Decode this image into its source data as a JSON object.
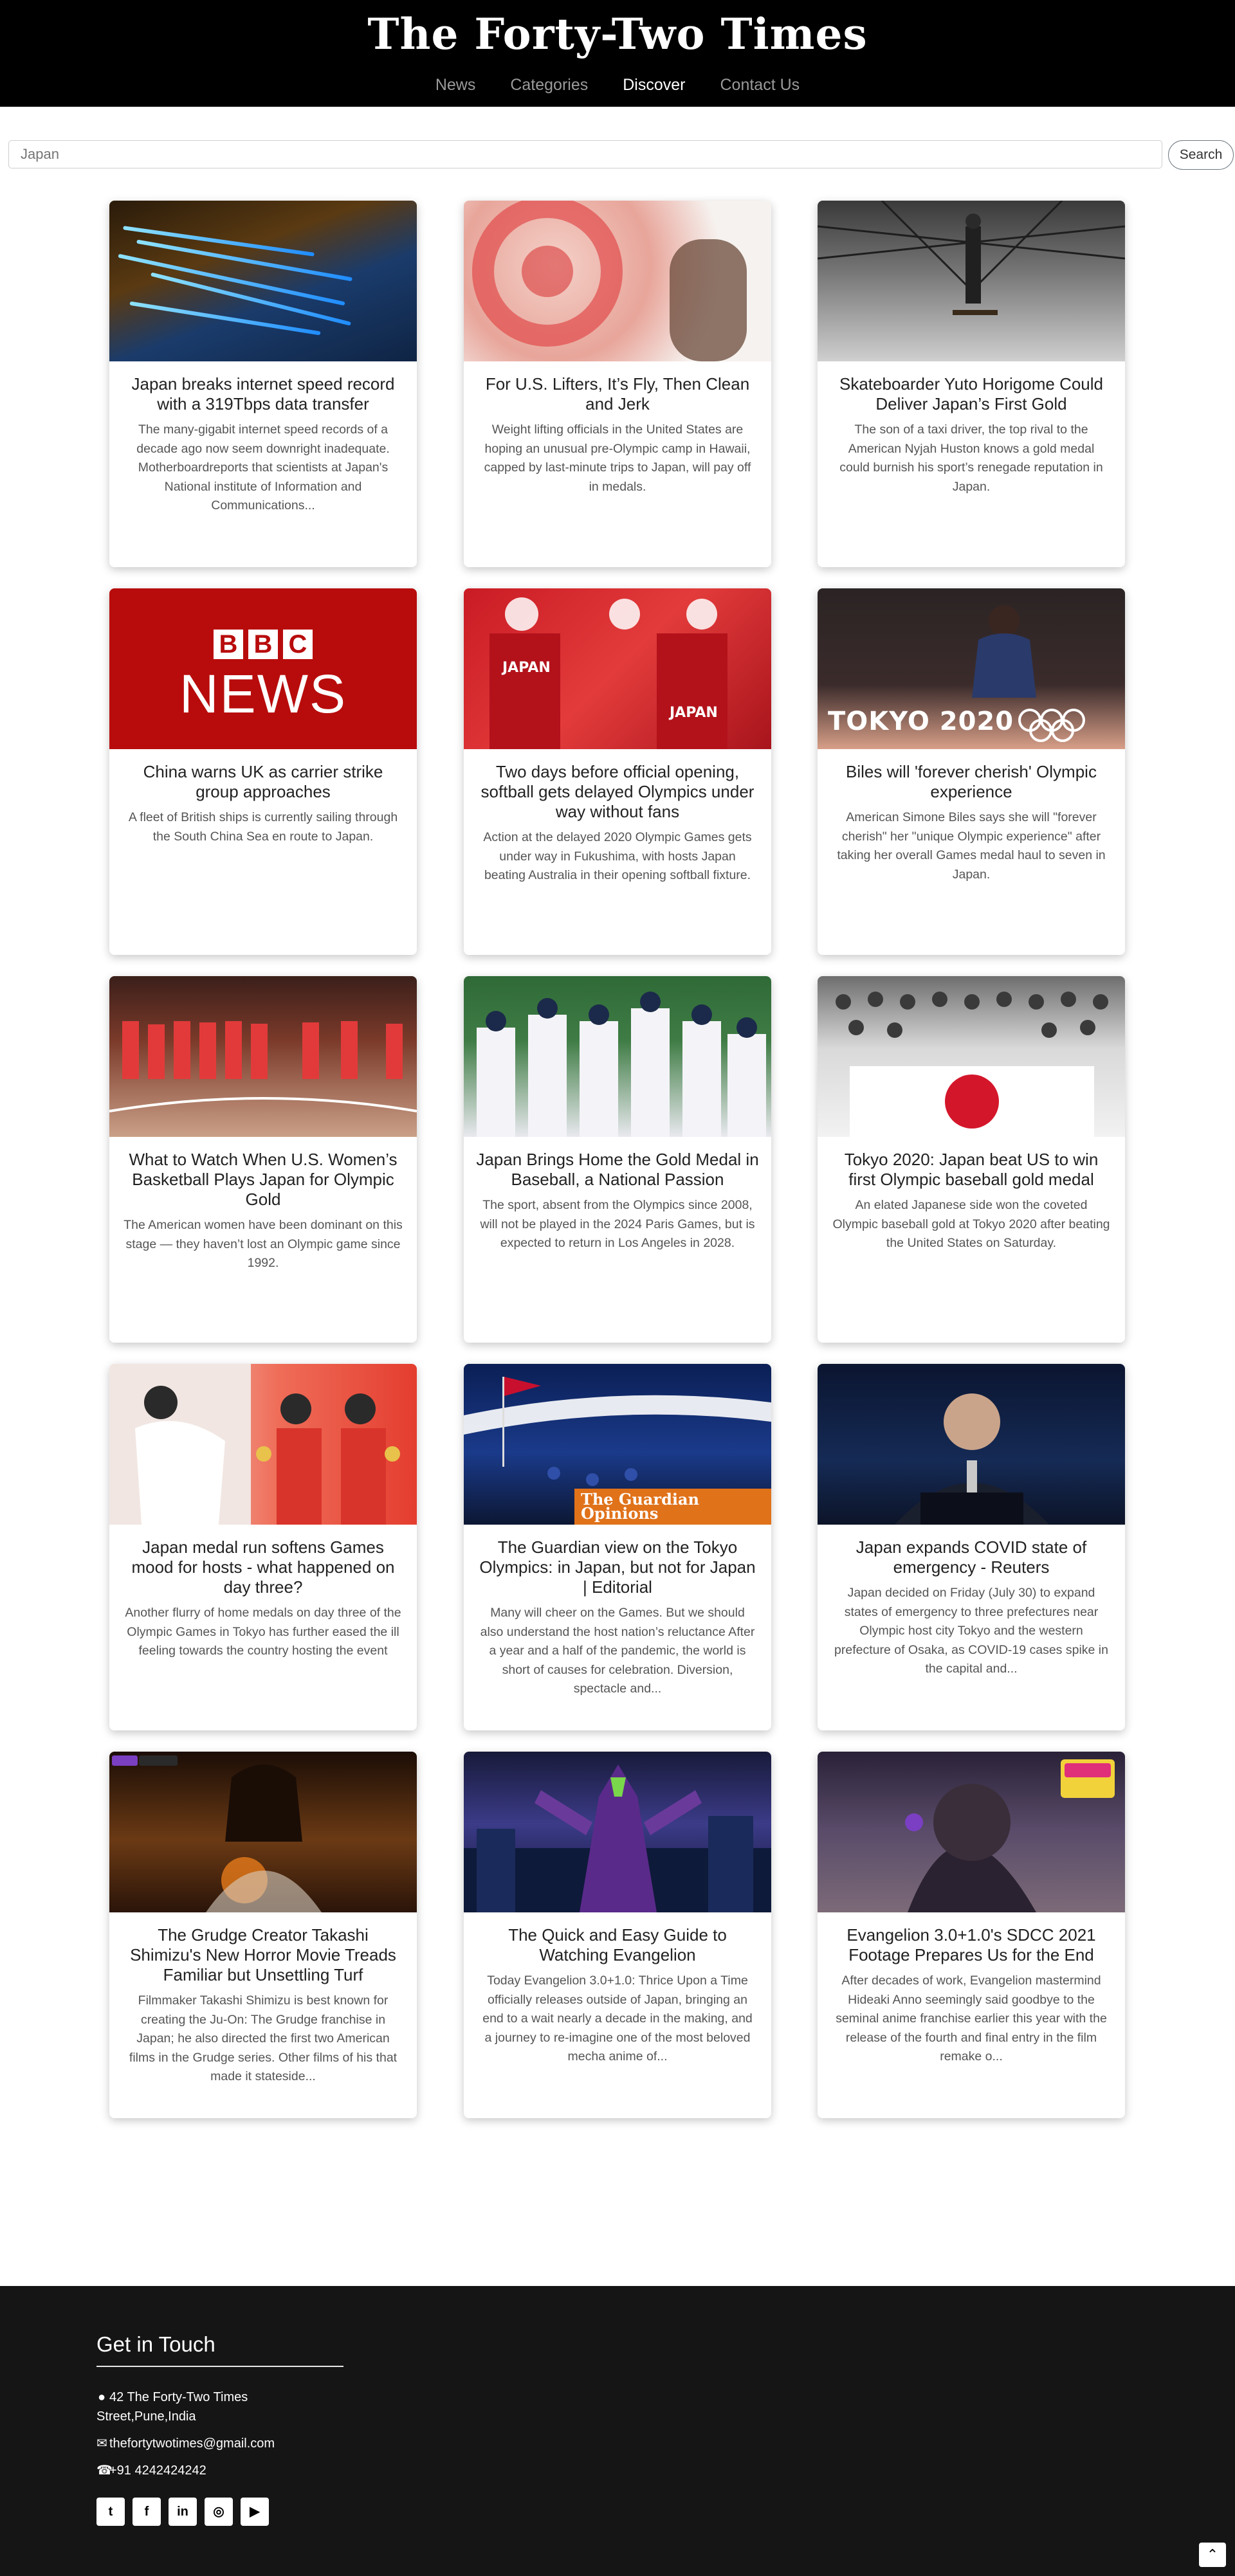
{
  "header": {
    "brand": "The Forty-Two Times",
    "nav": [
      {
        "label": "News",
        "active": false
      },
      {
        "label": "Categories",
        "active": false
      },
      {
        "label": "Discover",
        "active": true
      },
      {
        "label": "Contact Us",
        "active": false
      }
    ]
  },
  "search": {
    "placeholder": "Japan",
    "button_label": "Search"
  },
  "articles": [
    {
      "title": "Japan breaks internet speed record with a 319Tbps data transfer",
      "description": "The many-gigabit internet speed records of a decade ago now seem downright inadequate. Motherboardreports that scientists at Japan's National institute of Information and Communications..."
    },
    {
      "title": "For U.S. Lifters, It’s Fly, Then Clean and Jerk",
      "description": "Weight lifting officials in the United States are hoping an unusual pre-Olympic camp in Hawaii, capped by last-minute trips to Japan, will pay off in medals."
    },
    {
      "title": "Skateboarder Yuto Horigome Could Deliver Japan’s First Gold",
      "description": "The son of a taxi driver, the top rival to the American Nyjah Huston knows a gold medal could burnish his sport’s renegade reputation in Japan."
    },
    {
      "title": "China warns UK as carrier strike group approaches",
      "description": "A fleet of British ships is currently sailing through the South China Sea en route to Japan.",
      "thumb_logo": "BBC",
      "thumb_word": "NEWS"
    },
    {
      "title": "Two days before official opening, softball gets delayed Olympics under way without fans",
      "description": "Action at the delayed 2020 Olympic Games gets under way in Fukushima, with hosts Japan beating Australia in their opening softball fixture."
    },
    {
      "title": "Biles will 'forever cherish' Olympic experience",
      "description": "American Simone Biles says she will \"forever cherish\" her \"unique Olympic experience\" after taking her overall Games medal haul to seven in Japan.",
      "thumb_text": "TOKYO 2020"
    },
    {
      "title": "What to Watch When U.S. Women’s Basketball Plays Japan for Olympic Gold",
      "description": "The American women have been dominant on this stage — they haven’t lost an Olympic game since 1992."
    },
    {
      "title": "Japan Brings Home the Gold Medal in Baseball, a National Passion",
      "description": "The sport, absent from the Olympics since 2008, will not be played in the 2024 Paris Games, but is expected to return in Los Angeles in 2028."
    },
    {
      "title": "Tokyo 2020: Japan beat US to win first Olympic baseball gold medal",
      "description": "An elated Japanese side won the coveted Olympic baseball gold at Tokyo 2020 after beating the United States on Saturday."
    },
    {
      "title": "Japan medal run softens Games mood for hosts - what happened on day three?",
      "description": "Another flurry of home medals on day three of the Olympic Games in Tokyo has further eased the ill feeling towards the country hosting the event"
    },
    {
      "title": "The Guardian view on the Tokyo Olympics: in Japan, but not for Japan | Editorial",
      "description": "Many will cheer on the Games. But we should also understand the host nation’s reluctance After a year and a half of the pandemic, the world is short of causes for celebration. Diversion, spectacle and...",
      "thumb_text": "The Guardian Opinions"
    },
    {
      "title": "Japan expands COVID state of emergency - Reuters",
      "description": "Japan decided on Friday (July 30) to expand states of emergency to three prefectures near Olympic host city Tokyo and the western prefecture of Osaka, as COVID-19 cases spike in the capital and..."
    },
    {
      "title": "The Grudge Creator Takashi Shimizu's New Horror Movie Treads Familiar but Unsettling Turf",
      "description": "Filmmaker Takashi Shimizu is best known for creating the Ju-On: The Grudge franchise in Japan; he also directed the first two American films in the Grudge series. Other films of his that made it stateside..."
    },
    {
      "title": "The Quick and Easy Guide to Watching Evangelion",
      "description": "Today Evangelion 3.0+1.0: Thrice Upon a Time officially releases outside of Japan, bringing an end to a wait nearly a decade in the making, and a journey to re-imagine one of the most beloved mecha anime of..."
    },
    {
      "title": "Evangelion 3.0+1.0's SDCC 2021 Footage Prepares Us for the End",
      "description": "After decades of work, Evangelion mastermind Hideaki Anno seemingly said goodbye to the seminal anime franchise earlier this year with the release of the fourth and final entry in the film remake o..."
    }
  ],
  "footer": {
    "title": "Get in Touch",
    "address_line1": "42 The Forty-Two Times",
    "address_line2": "Street,Pune,India",
    "email": "thefortytwotimes@gmail.com",
    "phone": "+91 4242424242",
    "social": [
      {
        "icon": "twitter-icon",
        "glyph": "t"
      },
      {
        "icon": "facebook-icon",
        "glyph": "f"
      },
      {
        "icon": "linkedin-icon",
        "glyph": "in"
      },
      {
        "icon": "instagram-icon",
        "glyph": "◎"
      },
      {
        "icon": "youtube-icon",
        "glyph": "▶"
      }
    ]
  }
}
